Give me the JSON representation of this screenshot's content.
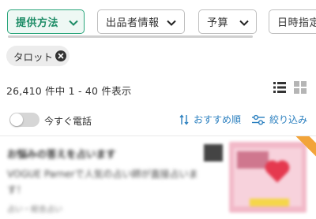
{
  "filters": {
    "chips": [
      {
        "label": "提供方法"
      },
      {
        "label": "出品者情報"
      },
      {
        "label": "予算"
      },
      {
        "label": "日時指定"
      }
    ]
  },
  "active_filter": {
    "tag_label": "タロット"
  },
  "results": {
    "count_text": "26,410 件中 1 - 40 件表示"
  },
  "toggles": {
    "call_now_label": "今すぐ電話"
  },
  "sort": {
    "recommended_label": "おすすめ順",
    "refine_label": "絞り込み"
  },
  "card": {
    "title": "お悩みの答えを占います",
    "description": "VOGUE Parnerで人気の占い師が直接占います！",
    "meta": "占い・総合占い"
  },
  "colors": {
    "accent_green": "#2aa57b",
    "link_blue": "#2a7fbf",
    "ribbon_orange": "#f2a43a"
  }
}
